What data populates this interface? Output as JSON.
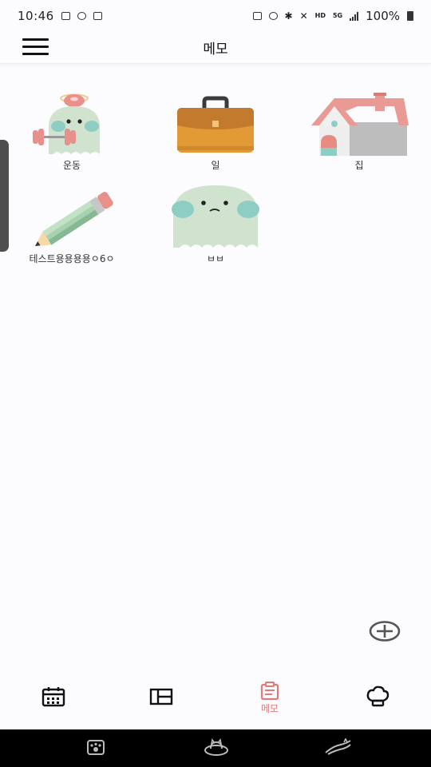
{
  "status_bar": {
    "time": "10:46",
    "network_label": "HD",
    "network_sub": "5G",
    "battery": "100%"
  },
  "header": {
    "title": "메모"
  },
  "memos": [
    {
      "label": "운동",
      "icon": "exercise-ghost-icon"
    },
    {
      "label": "일",
      "icon": "briefcase-icon"
    },
    {
      "label": "집",
      "icon": "house-icon"
    },
    {
      "label": "테스트용용용용ㅇ6ㅇ",
      "icon": "pencil-icon"
    },
    {
      "label": "ㅂㅂ",
      "icon": "ghost-icon"
    }
  ],
  "bottom_nav": {
    "items": [
      {
        "icon": "calendar-icon",
        "label": ""
      },
      {
        "icon": "layout-icon",
        "label": ""
      },
      {
        "icon": "memo-icon",
        "label": "메모",
        "active": true
      },
      {
        "icon": "chef-hat-icon",
        "label": ""
      }
    ],
    "active_color": "#e27a78"
  },
  "colors": {
    "accent": "#e27a78",
    "ghost_green": "#cfe3cf",
    "ghost_teal": "#8ecdc4",
    "briefcase": "#e19a36",
    "roof": "#e99a94"
  }
}
